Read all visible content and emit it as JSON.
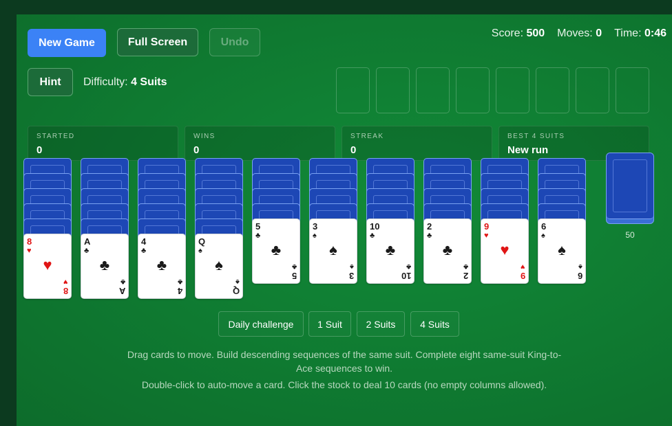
{
  "controls": {
    "new_game": "New Game",
    "full_screen": "Full Screen",
    "undo": "Undo",
    "hint": "Hint"
  },
  "hud": {
    "score_label": "Score:",
    "score": "500",
    "moves_label": "Moves:",
    "moves": "0",
    "time_label": "Time:",
    "time": "0:46"
  },
  "difficulty": {
    "label": "Difficulty:",
    "value": "4 Suits"
  },
  "stats": [
    {
      "label": "STARTED",
      "value": "0"
    },
    {
      "label": "WINS",
      "value": "0"
    },
    {
      "label": "STREAK",
      "value": "0"
    },
    {
      "label": "BEST 4 SUITS",
      "value": "New run"
    }
  ],
  "tableau": [
    {
      "hidden": 5,
      "top": {
        "rank": "8",
        "suit": "♥",
        "color": "red"
      }
    },
    {
      "hidden": 5,
      "top": {
        "rank": "A",
        "suit": "♣",
        "color": "black"
      }
    },
    {
      "hidden": 5,
      "top": {
        "rank": "4",
        "suit": "♣",
        "color": "black"
      }
    },
    {
      "hidden": 5,
      "top": {
        "rank": "Q",
        "suit": "♠",
        "color": "black"
      }
    },
    {
      "hidden": 4,
      "top": {
        "rank": "5",
        "suit": "♣",
        "color": "black"
      }
    },
    {
      "hidden": 4,
      "top": {
        "rank": "3",
        "suit": "♠",
        "color": "black"
      }
    },
    {
      "hidden": 4,
      "top": {
        "rank": "10",
        "suit": "♣",
        "color": "black"
      }
    },
    {
      "hidden": 4,
      "top": {
        "rank": "2",
        "suit": "♣",
        "color": "black"
      }
    },
    {
      "hidden": 4,
      "top": {
        "rank": "9",
        "suit": "♥",
        "color": "red"
      }
    },
    {
      "hidden": 4,
      "top": {
        "rank": "6",
        "suit": "♠",
        "color": "black"
      }
    }
  ],
  "stock": {
    "count": "50"
  },
  "modes": [
    "Daily challenge",
    "1 Suit",
    "2 Suits",
    "4 Suits"
  ],
  "help": {
    "line1": "Drag cards to move. Build descending sequences of the same suit. Complete eight same-suit King-to-",
    "line2": "Ace sequences to win.",
    "line3": "Double-click to auto-move a card. Click the stock to deal 10 cards (no empty columns allowed)."
  },
  "colors": {
    "felt": "#0f7a31",
    "card_back": "#1d47b5",
    "primary": "#3b82f6",
    "red_suit": "#e01515"
  }
}
